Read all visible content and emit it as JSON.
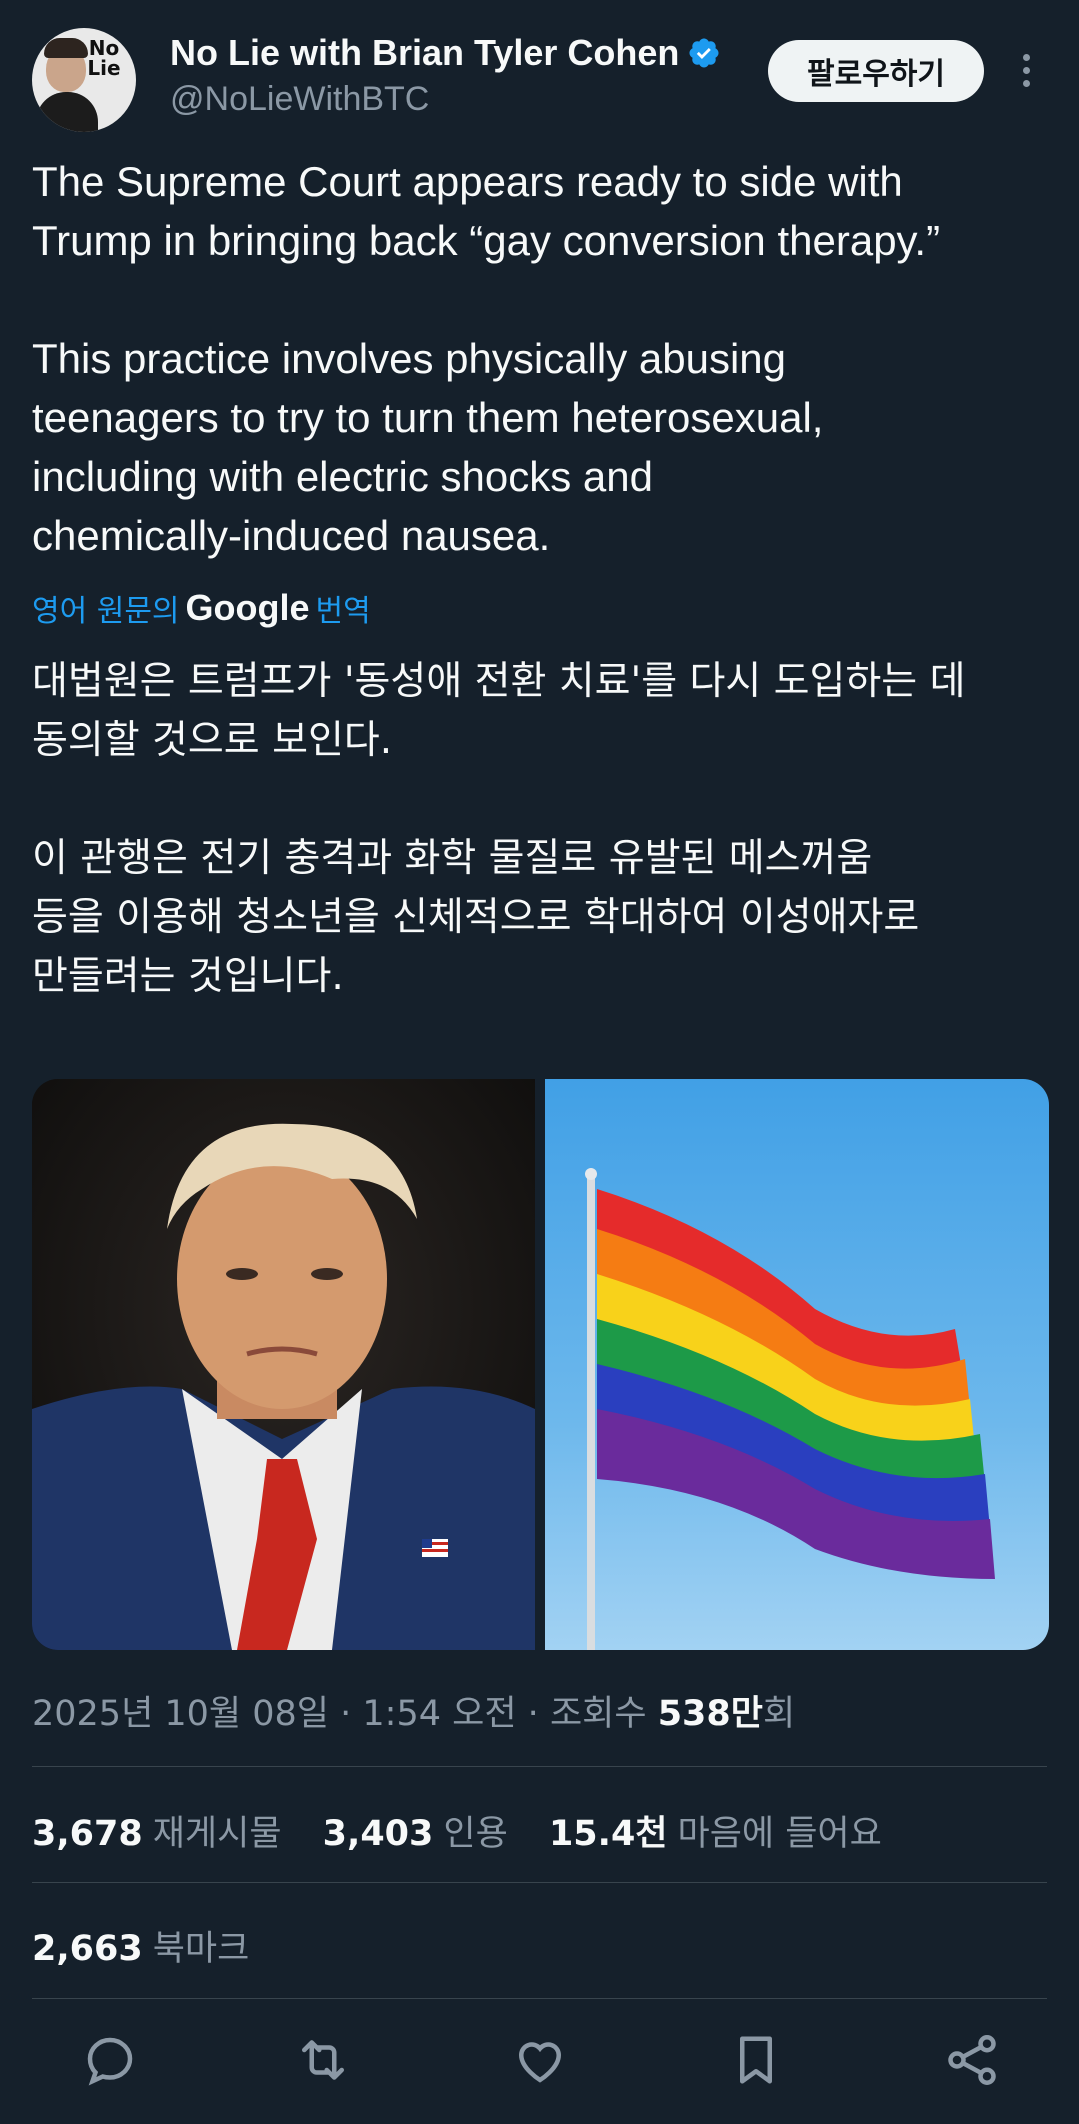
{
  "author": {
    "display_name": "No Lie with Brian Tyler Cohen",
    "handle": "@NoLieWithBTC",
    "avatar_logo": "No Lie",
    "verified_color": "#1d9bf0"
  },
  "follow_label": "팔로우하기",
  "tweet": {
    "text": "The Supreme Court appears ready to side with\nTrump in bringing back “gay conversion therapy.”\n\nThis practice involves physically abusing\nteenagers to try to turn them heterosexual,\nincluding with electric shocks and\nchemically-induced nausea."
  },
  "translation": {
    "prefix": "영어 원문의",
    "provider": "Google",
    "suffix": "번역",
    "text": "대법원은 트럼프가 '동성애 전환 치료'를 다시 도입하는 데\n동의할 것으로 보인다.\n\n이 관행은 전기 충격과 화학 물질로 유발된 메스꺼움\n등을 이용해 청소년을 신체적으로 학대하여 이성애자로\n만들려는 것입니다."
  },
  "meta": {
    "date": "2025년 10월 08일",
    "time": "1:54 오전",
    "views_label": "조회수",
    "views_value": "538만",
    "views_suffix": "회"
  },
  "stats": {
    "reposts_num": "3,678",
    "reposts_label": "재게시물",
    "quotes_num": "3,403",
    "quotes_label": "인용",
    "likes_num": "15.4천",
    "likes_label": "마음에 들어요",
    "bookmarks_num": "2,663",
    "bookmarks_label": "북마크"
  },
  "actions": [
    "reply-icon",
    "repost-icon",
    "like-icon",
    "bookmark-icon",
    "share-icon"
  ],
  "colors": {
    "background": "#15202b",
    "accent": "#1d9bf0",
    "secondary_text": "#8b98a5"
  }
}
